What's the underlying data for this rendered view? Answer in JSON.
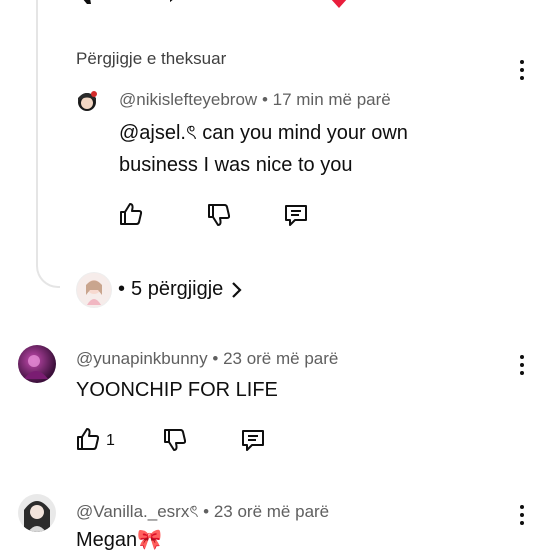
{
  "colors": {
    "text": "#0f0f0f",
    "meta": "#606060",
    "divider": "#e5e5e5",
    "heart": "#e91e3c"
  },
  "top_partial_actions": {
    "icons": [
      "dislike-icon",
      "reply-icon",
      "heart-icon"
    ]
  },
  "pinned_reply": {
    "header": "Përgjigje e theksuar",
    "author": "@nikislefteyebrow",
    "time": "17 min më parë",
    "text": "@ajsel.ৎ can you mind your own business I was nice to you"
  },
  "more_replies": {
    "label": "5 përgjigje"
  },
  "comments": [
    {
      "author": "@yunapinkbunny",
      "time": "23 orë më parë",
      "text": "YOONCHIP FOR LIFE",
      "likes": "1"
    },
    {
      "author": "@Vanilla._esrxৎ",
      "time": "23 orë më parë",
      "text": "Megan🎀"
    }
  ]
}
